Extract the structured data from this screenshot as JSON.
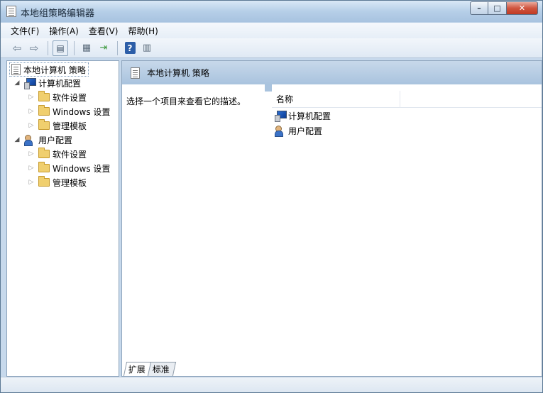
{
  "window": {
    "title": "本地组策略编辑器"
  },
  "menubar": {
    "items": [
      "文件(F)",
      "操作(A)",
      "查看(V)",
      "帮助(H)"
    ]
  },
  "toolbar": {
    "icons": [
      "back-arrow-icon",
      "forward-arrow-icon",
      "show-hide-tree-icon",
      "properties-icon",
      "export-list-icon",
      "help-icon",
      "filter-options-icon"
    ]
  },
  "tree": {
    "root": "本地计算机 策略",
    "computer_config": "计算机配置",
    "computer_children": [
      "软件设置",
      "Windows 设置",
      "管理模板"
    ],
    "user_config": "用户配置",
    "user_children": [
      "软件设置",
      "Windows 设置",
      "管理模板"
    ]
  },
  "right": {
    "header": "本地计算机 策略",
    "description": "选择一个项目来查看它的描述。",
    "column_name": "名称",
    "items": [
      "计算机配置",
      "用户配置"
    ]
  },
  "tabs": [
    "扩展",
    "标准"
  ],
  "colors": {
    "header_blue": "#a9c3de",
    "close_red": "#c03a23"
  }
}
